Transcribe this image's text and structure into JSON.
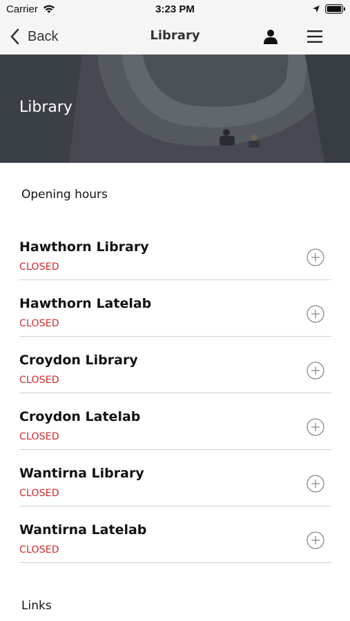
{
  "status_bar": {
    "carrier": "Carrier",
    "time": "3:23 PM",
    "icons": [
      "wifi-icon",
      "location-icon",
      "battery-icon"
    ]
  },
  "nav": {
    "back_label": "Back",
    "title": "Library",
    "icons": [
      "chevron-left-icon",
      "profile-icon",
      "menu-icon"
    ]
  },
  "hero": {
    "title": "Library"
  },
  "opening_hours": {
    "heading": "Opening hours",
    "items": [
      {
        "name": "Hawthorn Library",
        "status": "CLOSED"
      },
      {
        "name": "Hawthorn Latelab",
        "status": "CLOSED"
      },
      {
        "name": "Croydon Library",
        "status": "CLOSED"
      },
      {
        "name": "Croydon Latelab",
        "status": "CLOSED"
      },
      {
        "name": "Wantirna Library",
        "status": "CLOSED"
      },
      {
        "name": "Wantirna Latelab",
        "status": "CLOSED"
      }
    ]
  },
  "links": {
    "heading": "Links"
  },
  "colors": {
    "status_closed": "#d3272c",
    "nav_background": "#f5f5f5",
    "divider": "#cfcfcf"
  }
}
